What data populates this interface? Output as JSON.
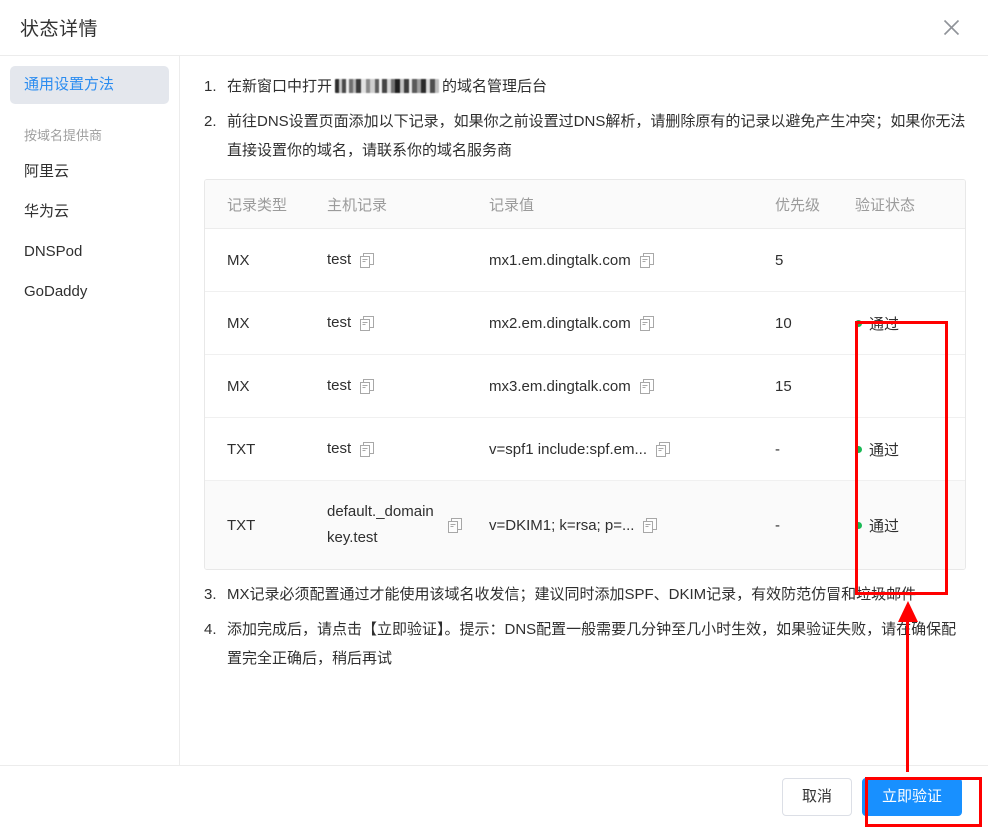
{
  "dialog": {
    "title": "状态详情",
    "close_icon": "close-icon"
  },
  "sidebar": {
    "primary": {
      "label": "通用设置方法"
    },
    "group_title": "按域名提供商",
    "providers": [
      {
        "label": "阿里云"
      },
      {
        "label": "华为云"
      },
      {
        "label": "DNSPod"
      },
      {
        "label": "GoDaddy"
      }
    ]
  },
  "steps": {
    "step1_prefix": "在新窗口中打开",
    "step1_suffix": "的域名管理后台",
    "step2": "前往DNS设置页面添加以下记录，如果你之前设置过DNS解析，请删除原有的记录以避免产生冲突；如果你无法直接设置你的域名，请联系你的域名服务商",
    "step3": "MX记录必须配置通过才能使用该域名收发信；建议同时添加SPF、DKIM记录，有效防范仿冒和垃圾邮件",
    "step4": "添加完成后，请点击【立即验证】。提示：DNS配置一般需要几分钟至几小时生效，如果验证失败，请在确保配置完全正确后，稍后再试"
  },
  "table": {
    "columns": [
      "记录类型",
      "主机记录",
      "记录值",
      "优先级",
      "验证状态"
    ],
    "copy_icon": "copy-icon",
    "rows": [
      {
        "type": "MX",
        "host": "test",
        "value": "mx1.em.dingtalk.com",
        "priority": "5",
        "status": "",
        "zebra": false
      },
      {
        "type": "MX",
        "host": "test",
        "value": "mx2.em.dingtalk.com",
        "priority": "10",
        "status": "通过",
        "zebra": false
      },
      {
        "type": "MX",
        "host": "test",
        "value": "mx3.em.dingtalk.com",
        "priority": "15",
        "status": "",
        "zebra": false
      },
      {
        "type": "TXT",
        "host": "test",
        "value": "v=spf1 include:spf.em...",
        "priority": "-",
        "status": "通过",
        "zebra": false
      },
      {
        "type": "TXT",
        "host": "default._domainkey.test",
        "value": "v=DKIM1; k=rsa; p=...",
        "priority": "-",
        "status": "通过",
        "zebra": true
      }
    ]
  },
  "footer": {
    "cancel_label": "取消",
    "verify_label": "立即验证"
  },
  "colors": {
    "primary": "#1890ff",
    "accent_link": "#2b8cf0",
    "status_dot": "#19b955",
    "annotation": "#ff0000",
    "sidebar_active_bg": "#e4e7ed"
  }
}
